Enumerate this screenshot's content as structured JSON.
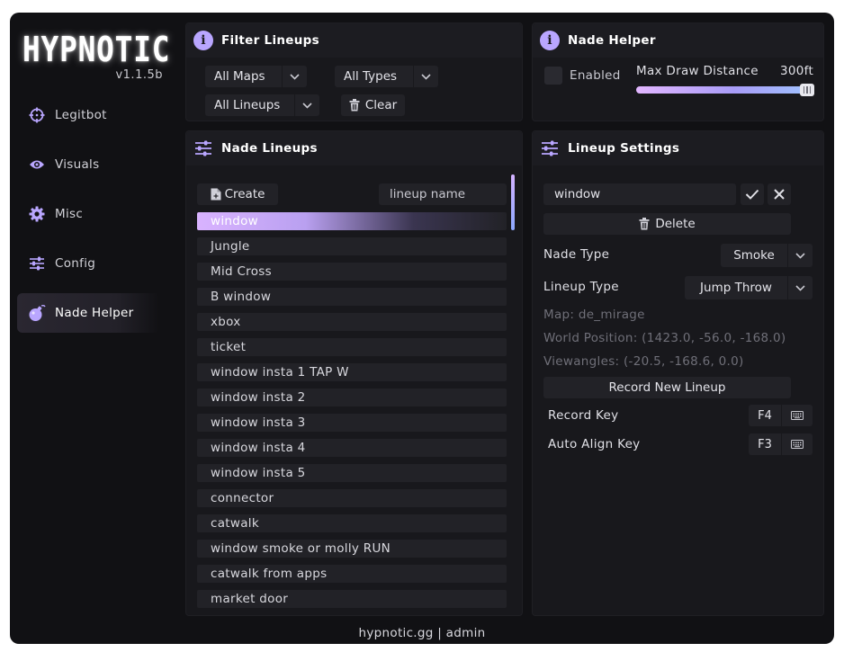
{
  "app": {
    "logo_text": "HYPNOTIC",
    "version": "v1.1.5b",
    "footer": "hypnotic.gg | admin"
  },
  "colors": {
    "accent": "#b9a6ff",
    "background": "#111114",
    "panel": "#18181c",
    "control": "#222227"
  },
  "sidebar": {
    "items": [
      {
        "label": "Legitbot",
        "icon": "crosshair-icon"
      },
      {
        "label": "Visuals",
        "icon": "eye-icon"
      },
      {
        "label": "Misc",
        "icon": "gear-icon"
      },
      {
        "label": "Config",
        "icon": "sliders-icon"
      },
      {
        "label": "Nade Helper",
        "icon": "grenade-icon",
        "active": true
      }
    ]
  },
  "filter_panel": {
    "title": "Filter Lineups",
    "maps_value": "All Maps",
    "types_value": "All Types",
    "lineups_value": "All Lineups",
    "clear_label": "Clear"
  },
  "helper_panel": {
    "title": "Nade Helper",
    "enabled_label": "Enabled",
    "enabled": false,
    "distance_label": "Max Draw Distance",
    "distance_value": "300ft",
    "distance_fraction": 1.0
  },
  "lineups_panel": {
    "title": "Nade Lineups",
    "create_label": "Create",
    "name_placeholder": "lineup name",
    "items": [
      "window",
      "Jungle",
      "Mid Cross",
      "B window",
      "xbox",
      "ticket",
      "window insta 1 TAP W",
      "window insta 2",
      "window insta 3",
      "window insta 4",
      "window insta 5",
      "connector",
      "catwalk",
      "window smoke or molly RUN",
      "catwalk from apps",
      "market door"
    ],
    "selected_index": 0
  },
  "settings_panel": {
    "title": "Lineup Settings",
    "name_value": "window",
    "delete_label": "Delete",
    "nade_type_label": "Nade Type",
    "nade_type_value": "Smoke",
    "lineup_type_label": "Lineup Type",
    "lineup_type_value": "Jump Throw",
    "map_text": "Map: de_mirage",
    "world_position_text": "World Position: (1423.0, -56.0, -168.0)",
    "viewangles_text": "Viewangles: (-20.5, -168.6, 0.0)",
    "record_new_label": "Record New Lineup",
    "record_key_label": "Record Key",
    "record_key_value": "F4",
    "auto_align_label": "Auto Align Key",
    "auto_align_value": "F3"
  }
}
